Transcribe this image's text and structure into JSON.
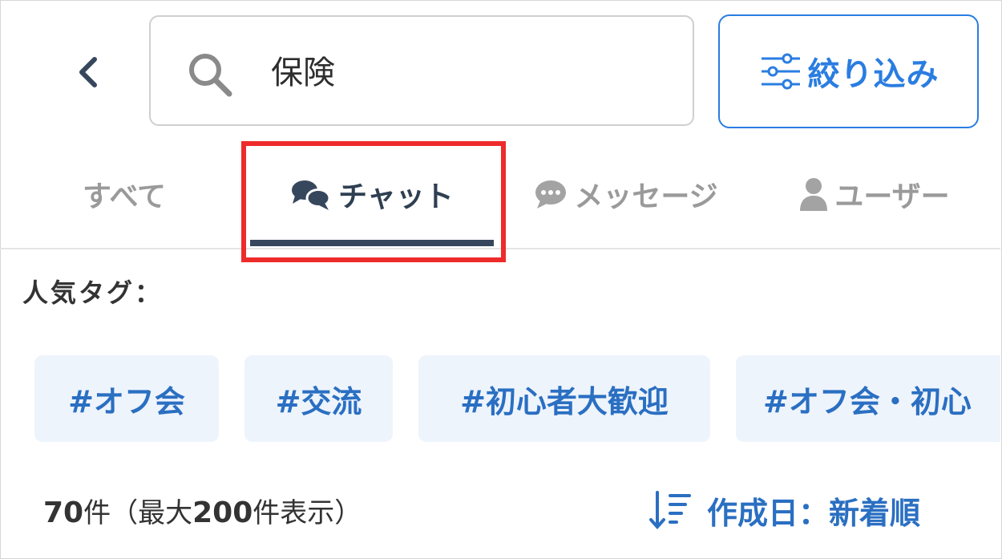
{
  "header": {
    "search": {
      "value": "保険"
    },
    "filter_label": "絞り込み"
  },
  "tabs": [
    {
      "label": "すべて",
      "active": false
    },
    {
      "label": "チャット",
      "active": true,
      "icon": "chat-bubbles-icon"
    },
    {
      "label": "メッセージ",
      "active": false,
      "icon": "message-bubble-icon"
    },
    {
      "label": "ユーザー",
      "active": false,
      "icon": "user-icon"
    }
  ],
  "popular_tags": {
    "heading": "人気タグ：",
    "items": [
      "#オフ会",
      "#交流",
      "#初心者大歓迎",
      "#オフ会・初心"
    ]
  },
  "results": {
    "count": "70",
    "count_suffix": "件（最大",
    "max": "200",
    "max_suffix": "件表示）"
  },
  "sort": {
    "label": "作成日：新着順",
    "icon": "sort-descending-icon"
  },
  "colors": {
    "accent": "#2a7de1",
    "tag_text": "#2a6fc2",
    "tag_bg": "#eef4fc",
    "active_tab": "#2f3f52",
    "highlight": "#ee2b2b"
  }
}
